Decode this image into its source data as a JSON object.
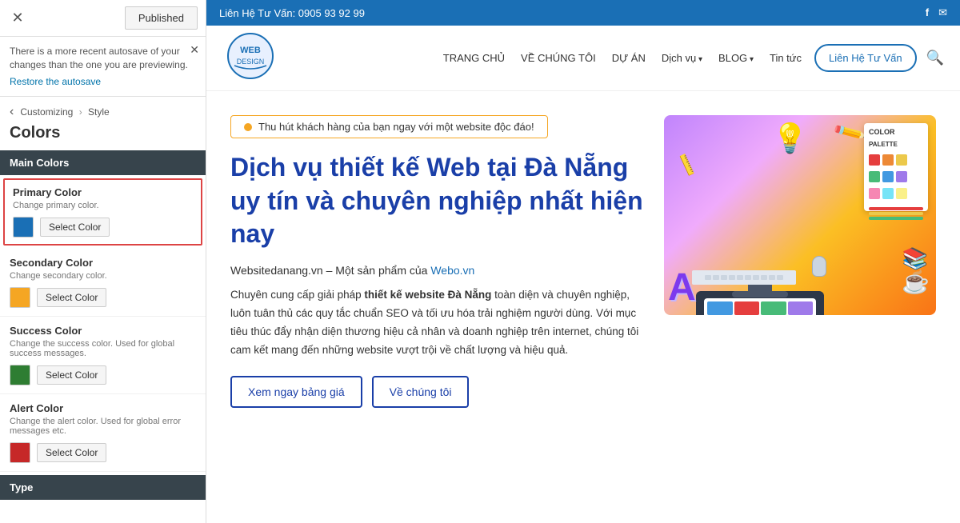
{
  "left_panel": {
    "close_label": "✕",
    "published_label": "Published",
    "autosave_notice": "There is a more recent autosave of your changes than the one you are previewing.",
    "autosave_link": "Restore the autosave",
    "breadcrumb": {
      "back_icon": "‹",
      "path_1": "Customizing",
      "separator": "›",
      "path_2": "Style"
    },
    "page_title": "Colors",
    "sections": {
      "main_colors_header": "Main Colors",
      "primary_color": {
        "title": "Primary Color",
        "description": "Change primary color.",
        "swatch_color": "#1a6fb5",
        "button_label": "Select Color"
      },
      "secondary_color": {
        "title": "Secondary Color",
        "description": "Change secondary color.",
        "swatch_color": "#f5a623",
        "button_label": "Select Color"
      },
      "success_color": {
        "title": "Success Color",
        "description": "Change the success color. Used for global success messages.",
        "swatch_color": "#2e7d32",
        "button_label": "Select Color"
      },
      "alert_color": {
        "title": "Alert Color",
        "description": "Change the alert color. Used for global error messages etc.",
        "swatch_color": "#c62828",
        "button_label": "Select Color"
      }
    },
    "type_header": "Type"
  },
  "right_panel": {
    "info_bar": {
      "phone_text": "Liên Hệ Tư Vấn: 0905 93 92 99",
      "fb_icon": "f",
      "mail_icon": "✉"
    },
    "nav": {
      "links": [
        {
          "label": "TRANG CHỦ",
          "dropdown": false
        },
        {
          "label": "VỀ CHÚNG TÔI",
          "dropdown": false
        },
        {
          "label": "DỰ ÁN",
          "dropdown": false
        },
        {
          "label": "Dịch vụ",
          "dropdown": true
        },
        {
          "label": "BLOG",
          "dropdown": true
        },
        {
          "label": "Tin tức",
          "dropdown": false
        }
      ],
      "consult_btn": "Liên Hệ Tư Vấn"
    },
    "hero": {
      "badge_text": "Thu hút khách hàng của bạn ngay với một website độc đáo!",
      "title": "Dịch vụ thiết kế Web tại Đà Nẵng uy tín và chuyên nghiệp nhất hiện nay",
      "subtitle_plain": "Websitedanang.vn – Một sản phẩm của ",
      "subtitle_link_text": "Webo.vn",
      "subtitle_link_url": "#",
      "body_html": "Chuyên cung cấp giải pháp <strong>thiết kế website Đà Nẵng</strong> toàn diện và chuyên nghiệp, luôn tuân thủ các quy tắc chuẩn SEO và tối ưu hóa trải nghiệm người dùng. Với mục tiêu thúc đẩy nhận diện thương hiệu cả nhân và doanh nghiệp trên internet, chúng tôi cam kết mang đến những website vượt trội về chất lượng và hiệu quả.",
      "btn_1": "Xem ngay bảng giá",
      "btn_2": "Về chúng tôi"
    }
  }
}
